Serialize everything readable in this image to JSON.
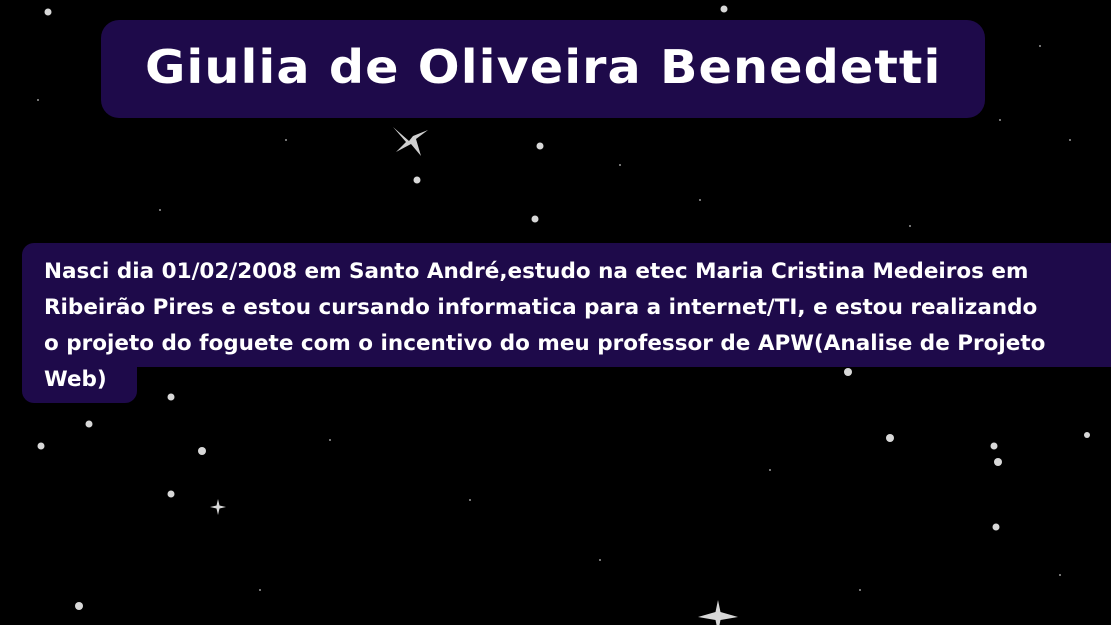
{
  "header": {
    "title": "Giulia de Oliveira Benedetti"
  },
  "bio": {
    "lines": [
      "Nasci dia 01/02/2008 em Santo André,estudo na etec Maria Cristina Medeiros em",
      "Ribeirão Pires e estou cursando informatica para a internet/TI, e estou realizando",
      "o projeto do foguete com o incentivo do meu professor de APW(Analise de Projeto",
      "Web)"
    ]
  },
  "colors": {
    "background": "#000000",
    "panel": "#1e0a4a",
    "text": "#ffffff",
    "star": "#d8d8d8"
  }
}
